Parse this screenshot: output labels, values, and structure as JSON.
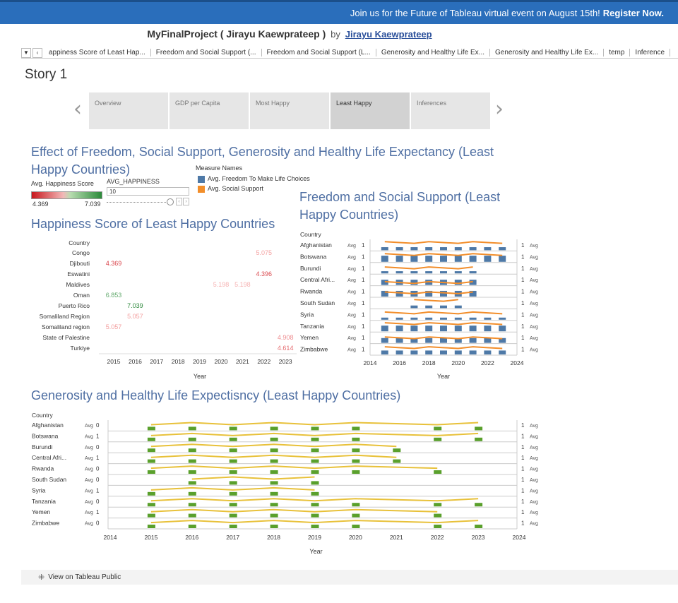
{
  "banner": {
    "text": "Join us for the Future of Tableau virtual event on August 15th!",
    "link": "Register Now."
  },
  "project": {
    "name": "MyFinalProject ( Jirayu Kaewprateep )",
    "by": "by",
    "author": "Jirayu Kaewprateep"
  },
  "tabs": [
    "appiness Score of Least Hap...",
    "Freedom and Social Support (...",
    "Freedom and Social Support (L...",
    "Generosity and Healthy Life Ex...",
    "Generosity and Healthy Life Ex...",
    "temp",
    "Inference"
  ],
  "story": {
    "title": "Story 1",
    "points": [
      "Overview",
      "GDP per Capita",
      "Most Happy",
      "Least Happy",
      "Inferences"
    ],
    "active_index": 3
  },
  "dashboard": {
    "title_line1": "Effect of Freedom, Social Support, Generosity and Healthy Life Expectancy (Least",
    "title_line2": "Happy Countries)"
  },
  "legend": {
    "color_title": "Avg. Happiness Score",
    "min": "4.369",
    "max": "7.039",
    "param_title": "AVG_HAPPINESS",
    "param_value": "10",
    "measure_title": "Measure Names",
    "measures": [
      "Avg. Freedom To Make Life Choices",
      "Avg. Social Support"
    ],
    "measure_colors": [
      "#4e79a7",
      "#f28e2b"
    ]
  },
  "happiness": {
    "title": "Happiness Score of Least Happy Countries",
    "country_header": "Country",
    "xlabel": "Year",
    "countries": [
      "Congo",
      "Djibouti",
      "Eswatini",
      "Maldives",
      "Oman",
      "Puerto Rico",
      "Somaliland Region",
      "Somaliland region",
      "State of Palestine",
      "Turkiye"
    ],
    "years": [
      "2015",
      "2016",
      "2017",
      "2018",
      "2019",
      "2020",
      "2021",
      "2022",
      "2023"
    ],
    "points": [
      {
        "row": 0,
        "year": 2022,
        "value": "5.075",
        "color": "#f4a3a3"
      },
      {
        "row": 1,
        "year": 2015,
        "value": "4.369",
        "color": "#d9434a"
      },
      {
        "row": 2,
        "year": 2022,
        "value": "4.396",
        "color": "#db4b50"
      },
      {
        "row": 3,
        "year": 2020,
        "value": "5.198",
        "color": "#f6b2b2"
      },
      {
        "row": 3,
        "year": 2021,
        "value": "5.198",
        "color": "#f6b2b2"
      },
      {
        "row": 4,
        "year": 2015,
        "value": "6.853",
        "color": "#5fa86a"
      },
      {
        "row": 5,
        "year": 2016,
        "value": "7.039",
        "color": "#2f8a3e"
      },
      {
        "row": 6,
        "year": 2016,
        "value": "5.057",
        "color": "#f3a0a0"
      },
      {
        "row": 7,
        "year": 2015,
        "value": "5.057",
        "color": "#f3a0a0"
      },
      {
        "row": 8,
        "year": 2023,
        "value": "4.908",
        "color": "#ee8c8f"
      },
      {
        "row": 9,
        "year": 2023,
        "value": "4.614",
        "color": "#e56a6e"
      }
    ]
  },
  "freedom": {
    "title_line1": "Freedom and Social Support (Least",
    "title_line2": "Happy Countries)",
    "country_header": "Country",
    "xlabel": "Year",
    "countries": [
      "Afghanistan",
      "Botswana",
      "Burundi",
      "Central Afri...",
      "Rwanda",
      "South Sudan",
      "Syria",
      "Tanzania",
      "Yemen",
      "Zimbabwe"
    ],
    "years": [
      "2014",
      "2016",
      "2018",
      "2020",
      "2022",
      "2024"
    ],
    "row_marks": [
      "1",
      "1",
      "1",
      "1",
      "1",
      "1",
      "1",
      "1",
      "1",
      "1"
    ],
    "right_marks": [
      "1",
      "1",
      "1",
      "1",
      "1",
      "1",
      "1",
      "1",
      "1",
      "1"
    ],
    "bars_years": [
      [
        2015,
        2016,
        2017,
        2018,
        2019,
        2020,
        2021,
        2022,
        2023
      ],
      [
        2015,
        2016,
        2017,
        2018,
        2019,
        2020,
        2021,
        2022,
        2023
      ],
      [
        2015,
        2016,
        2017,
        2018,
        2019,
        2020,
        2021
      ],
      [
        2015,
        2016,
        2017,
        2018,
        2019,
        2020,
        2021
      ],
      [
        2015,
        2016,
        2017,
        2018,
        2019,
        2020,
        2021
      ],
      [
        2017,
        2018,
        2019,
        2020
      ],
      [
        2015,
        2016,
        2017,
        2018,
        2019,
        2020,
        2021,
        2022,
        2023
      ],
      [
        2015,
        2016,
        2017,
        2018,
        2019,
        2020,
        2021,
        2022,
        2023
      ],
      [
        2015,
        2016,
        2017,
        2018,
        2019,
        2020,
        2021,
        2022,
        2023
      ],
      [
        2015,
        2016,
        2017,
        2018,
        2019,
        2020,
        2021,
        2022,
        2023
      ]
    ],
    "bar_level": [
      0.35,
      0.7,
      0.25,
      0.6,
      0.65,
      0.3,
      0.2,
      0.65,
      0.55,
      0.45
    ],
    "line_level": [
      0.8,
      0.75,
      0.55,
      0.2,
      0.35,
      0.8,
      0.7,
      0.8,
      0.5,
      0.7
    ]
  },
  "generosity": {
    "title": "Generosity and Healthy Life Expectisncy (Least Happy Countries)",
    "country_header": "Country",
    "xlabel": "Year",
    "countries": [
      "Afghanistan",
      "Botswana",
      "Burundi",
      "Central Afri...",
      "Rwanda",
      "South Sudan",
      "Syria",
      "Tanzania",
      "Yemen",
      "Zimbabwe"
    ],
    "years": [
      "2014",
      "2015",
      "2016",
      "2017",
      "2018",
      "2019",
      "2020",
      "2021",
      "2022",
      "2023",
      "2024"
    ],
    "row_marks": [
      "0",
      "1",
      "0",
      "1",
      "0",
      "0",
      "1",
      "0",
      "1",
      "0"
    ],
    "right_marks": [
      "1",
      "1",
      "1",
      "1",
      "1",
      "1",
      "1",
      "1",
      "1",
      "1"
    ],
    "years_present": [
      [
        2015,
        2016,
        2017,
        2018,
        2019,
        2020,
        2022,
        2023
      ],
      [
        2015,
        2016,
        2017,
        2018,
        2019,
        2020,
        2022,
        2023
      ],
      [
        2015,
        2016,
        2017,
        2018,
        2019,
        2020,
        2021
      ],
      [
        2015,
        2016,
        2017,
        2018,
        2019,
        2020,
        2021
      ],
      [
        2015,
        2016,
        2017,
        2018,
        2019,
        2020,
        2022
      ],
      [
        2016,
        2017,
        2018,
        2019
      ],
      [
        2015,
        2016,
        2017,
        2018,
        2019
      ],
      [
        2015,
        2016,
        2017,
        2018,
        2019,
        2020,
        2022,
        2023
      ],
      [
        2015,
        2016,
        2017,
        2018,
        2019,
        2020,
        2022
      ],
      [
        2015,
        2016,
        2017,
        2018,
        2019,
        2020,
        2022,
        2023
      ]
    ]
  },
  "footer": {
    "label": "View on Tableau Public"
  },
  "colors": {
    "accent": "#2a6ebb",
    "title": "#4f6fa3",
    "bar": "#4e79a7",
    "line": "#f28e2b",
    "green": "#5aa02c",
    "yellow": "#e8c13a"
  }
}
